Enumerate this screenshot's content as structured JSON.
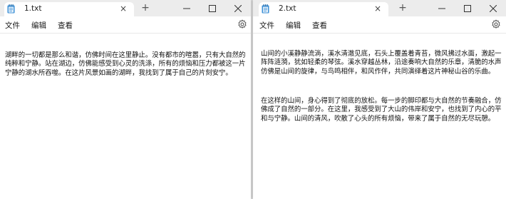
{
  "left": {
    "tab_title": "1.txt",
    "menu": [
      "文件",
      "编辑",
      "查看"
    ],
    "paragraphs": [
      "湖畔的一切都是那么和谐，仿佛时间在这里静止。没有都市的喧嚣，只有大自然的纯粹和宁静。站在湖边，仿佛能感受到心灵的洗涤，所有的烦恼和压力都被这一片宁静的湖水所吞噬。在这片风景如画的湖畔，我找到了属于自己的片刻安宁。"
    ]
  },
  "right": {
    "tab_title": "2.txt",
    "menu": [
      "文件",
      "编辑",
      "查看"
    ],
    "paragraphs": [
      "山间的小溪静静流淌，溪水清澈见底，石头上覆盖着青苔，微风拂过水面，激起一阵阵涟漪，犹如轻柔的琴弦。溪水穿越丛林，沿途奏响大自然的乐章，清脆的水声仿佛是山间的旋律，与鸟鸣相伴，和风作伴，共同演绎着这片神秘山谷的乐曲。",
      "在这样的山间，身心得到了彻底的放松。每一步的脚印都与大自然的节奏融合，仿佛成了自然的一部分。在这里，我感受到了大山的伟岸和安宁，也找到了内心的平和与宁静。山间的清风，吹散了心头的所有烦恼，带来了属于自然的无尽玩憩。"
    ]
  },
  "icons": {
    "close_tab": "×",
    "new_tab": "+",
    "notepad_icon": "notepad-icon",
    "settings_icon": "gear-icon",
    "minimize_icon": "minimize-icon",
    "maximize_icon": "maximize-icon",
    "close_window_icon": "close-icon"
  },
  "colors": {
    "titlebar": "#ececec",
    "content": "#ffffff",
    "accent": "#3a8fd6"
  }
}
